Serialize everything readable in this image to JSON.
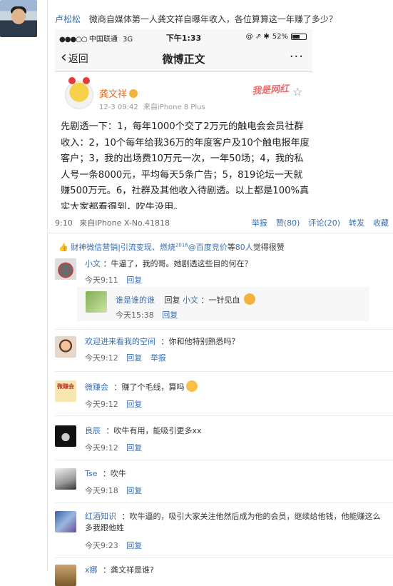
{
  "post": {
    "author": "卢松松",
    "text": "微商自媒体第一人龚文祥自曝年收入，各位算算这一年赚了多少？"
  },
  "phone": {
    "status": {
      "carrier": "中国联通",
      "network": "3G",
      "time": "下午1:33",
      "right_icons": "@ ⇗ ✱",
      "battery": "52%"
    },
    "nav": {
      "back": "返回",
      "title": "微博正文",
      "more": "···"
    },
    "weibo": {
      "author": "龚文祥",
      "time": "12-3 09:42",
      "source": "来自iPhone 8 Plus",
      "watermark": "我是网红",
      "body": "先剧透一下：1，每年1000个交了2万元的触电会会员社群收入：2，10个每年给我36万的年度客户及10个触电报年度客户；3，我的出场费10万元一次，一年50场；4，我的私人号一条8000元，平均每天5条广告；5，819论坛一天就赚500万元。6，社群及其他收入待剧透。以上都是100%真实大家都看得到，吹牛没用。"
    }
  },
  "post_footer": {
    "time": "9:10",
    "source": "来自iPhone X-No.41818",
    "report": "举报",
    "like": "赞(80)",
    "comment": "评论(20)",
    "forward": "转发",
    "favorite": "收藏"
  },
  "likes": {
    "names": "财神",
    "rest": "微信营销|引流变现、燃烧",
    "sup": "2016",
    "at": "@百度竞价",
    "tail": "等",
    "count": "80人",
    "suffix": "觉得很赞"
  },
  "comments": [
    {
      "name": "小文",
      "text": "：牛逼了，我的哥。她剧透这些目的何在？",
      "time": "今天9:11",
      "reply": "回复"
    },
    {
      "name": "欢迎进来看我的空间",
      "text": "：你和他特别熟悉吗？",
      "time": "今天9:12",
      "reply": "回复",
      "report": "举报"
    },
    {
      "name": "微赚会",
      "text": "：赚了个毛线，算吗",
      "time": "今天9:12",
      "reply": "回复"
    },
    {
      "name": "良辰",
      "text": "：吹牛有用，能吸引更多xx",
      "time": "今天9:12",
      "reply": "回复"
    },
    {
      "name": "Tse",
      "text": "：吹牛",
      "time": "今天9:18",
      "reply": "回复"
    },
    {
      "name": "红酒知识",
      "text": "：吹牛逼的，吸引大家关注他然后成为他的会员，继续给他钱，他能赚这么多我跟他姓",
      "time": "今天9:23",
      "reply": "回复"
    },
    {
      "name": "x娜",
      "text": "：龚文祥是谁?"
    }
  ],
  "nested_reply": {
    "name": "谁是谁的谁",
    "reply_word": "回复",
    "target": "小文",
    "text": "：一针见血",
    "time": "今天15:38",
    "reply": "回复"
  },
  "avatar_texts": {
    "weizhuanhui": "微赚会"
  }
}
